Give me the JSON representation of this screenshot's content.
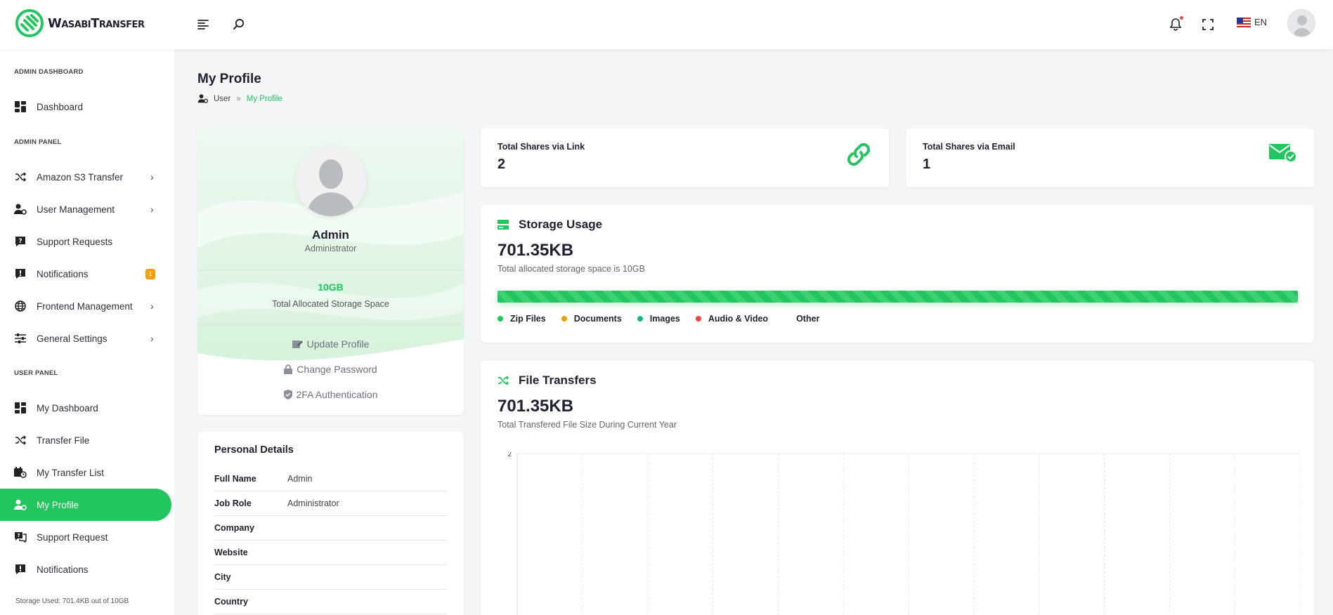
{
  "header": {
    "brand": "WasabiTransfer",
    "language": "EN"
  },
  "sidebar": {
    "sections": {
      "admin_dashboard": "ADMIN DASHBOARD",
      "admin_panel": "ADMIN PANEL",
      "user_panel": "USER PANEL"
    },
    "items": [
      {
        "label": "Dashboard"
      },
      {
        "label": "Amazon S3 Transfer"
      },
      {
        "label": "User Management"
      },
      {
        "label": "Support Requests"
      },
      {
        "label": "Notifications",
        "badge": "1"
      },
      {
        "label": "Frontend Management"
      },
      {
        "label": "General Settings"
      },
      {
        "label": "My Dashboard"
      },
      {
        "label": "Transfer File"
      },
      {
        "label": "My Transfer List"
      },
      {
        "label": "My Profile"
      },
      {
        "label": "Support Request"
      },
      {
        "label": "Notifications"
      }
    ],
    "storage_footer": "Storage Used: 701.4KB out of 10GB"
  },
  "page": {
    "title": "My Profile",
    "breadcrumb": {
      "parent": "User",
      "separator": "»",
      "current": "My Profile"
    }
  },
  "profile": {
    "name": "Admin",
    "role": "Administrator",
    "storage_value": "10GB",
    "storage_label": "Total Allocated Storage Space",
    "links": {
      "update": "Update Profile",
      "password": "Change Password",
      "twofa": "2FA Authentication"
    }
  },
  "details": {
    "title": "Personal Details",
    "rows": [
      {
        "label": "Full Name",
        "value": "Admin"
      },
      {
        "label": "Job Role",
        "value": "Administrator"
      },
      {
        "label": "Company",
        "value": ""
      },
      {
        "label": "Website",
        "value": ""
      },
      {
        "label": "City",
        "value": ""
      },
      {
        "label": "Country",
        "value": ""
      }
    ]
  },
  "stats": {
    "link": {
      "title": "Total Shares via Link",
      "value": "2"
    },
    "email": {
      "title": "Total Shares via Email",
      "value": "1"
    }
  },
  "storage": {
    "title": "Storage Usage",
    "value": "701.35KB",
    "subtitle": "Total allocated storage space is 10GB",
    "legend": [
      {
        "label": "Zip Files",
        "color": "#22c55e"
      },
      {
        "label": "Documents",
        "color": "#f59e0b"
      },
      {
        "label": "Images",
        "color": "#10b981"
      },
      {
        "label": "Audio & Video",
        "color": "#ef4444"
      },
      {
        "label": "Other",
        "color": "#ffffff"
      }
    ]
  },
  "transfers": {
    "title": "File Transfers",
    "value": "701.35KB",
    "subtitle": "Total Transfered File Size During Current Year"
  },
  "chart_data": {
    "type": "line",
    "title": "",
    "xlabel": "",
    "ylabel": "",
    "y_tick_labels": [
      "2"
    ],
    "vertical_gridlines": 12,
    "series": []
  },
  "colors": {
    "accent": "#22c55e",
    "badge": "#f59e0b"
  }
}
